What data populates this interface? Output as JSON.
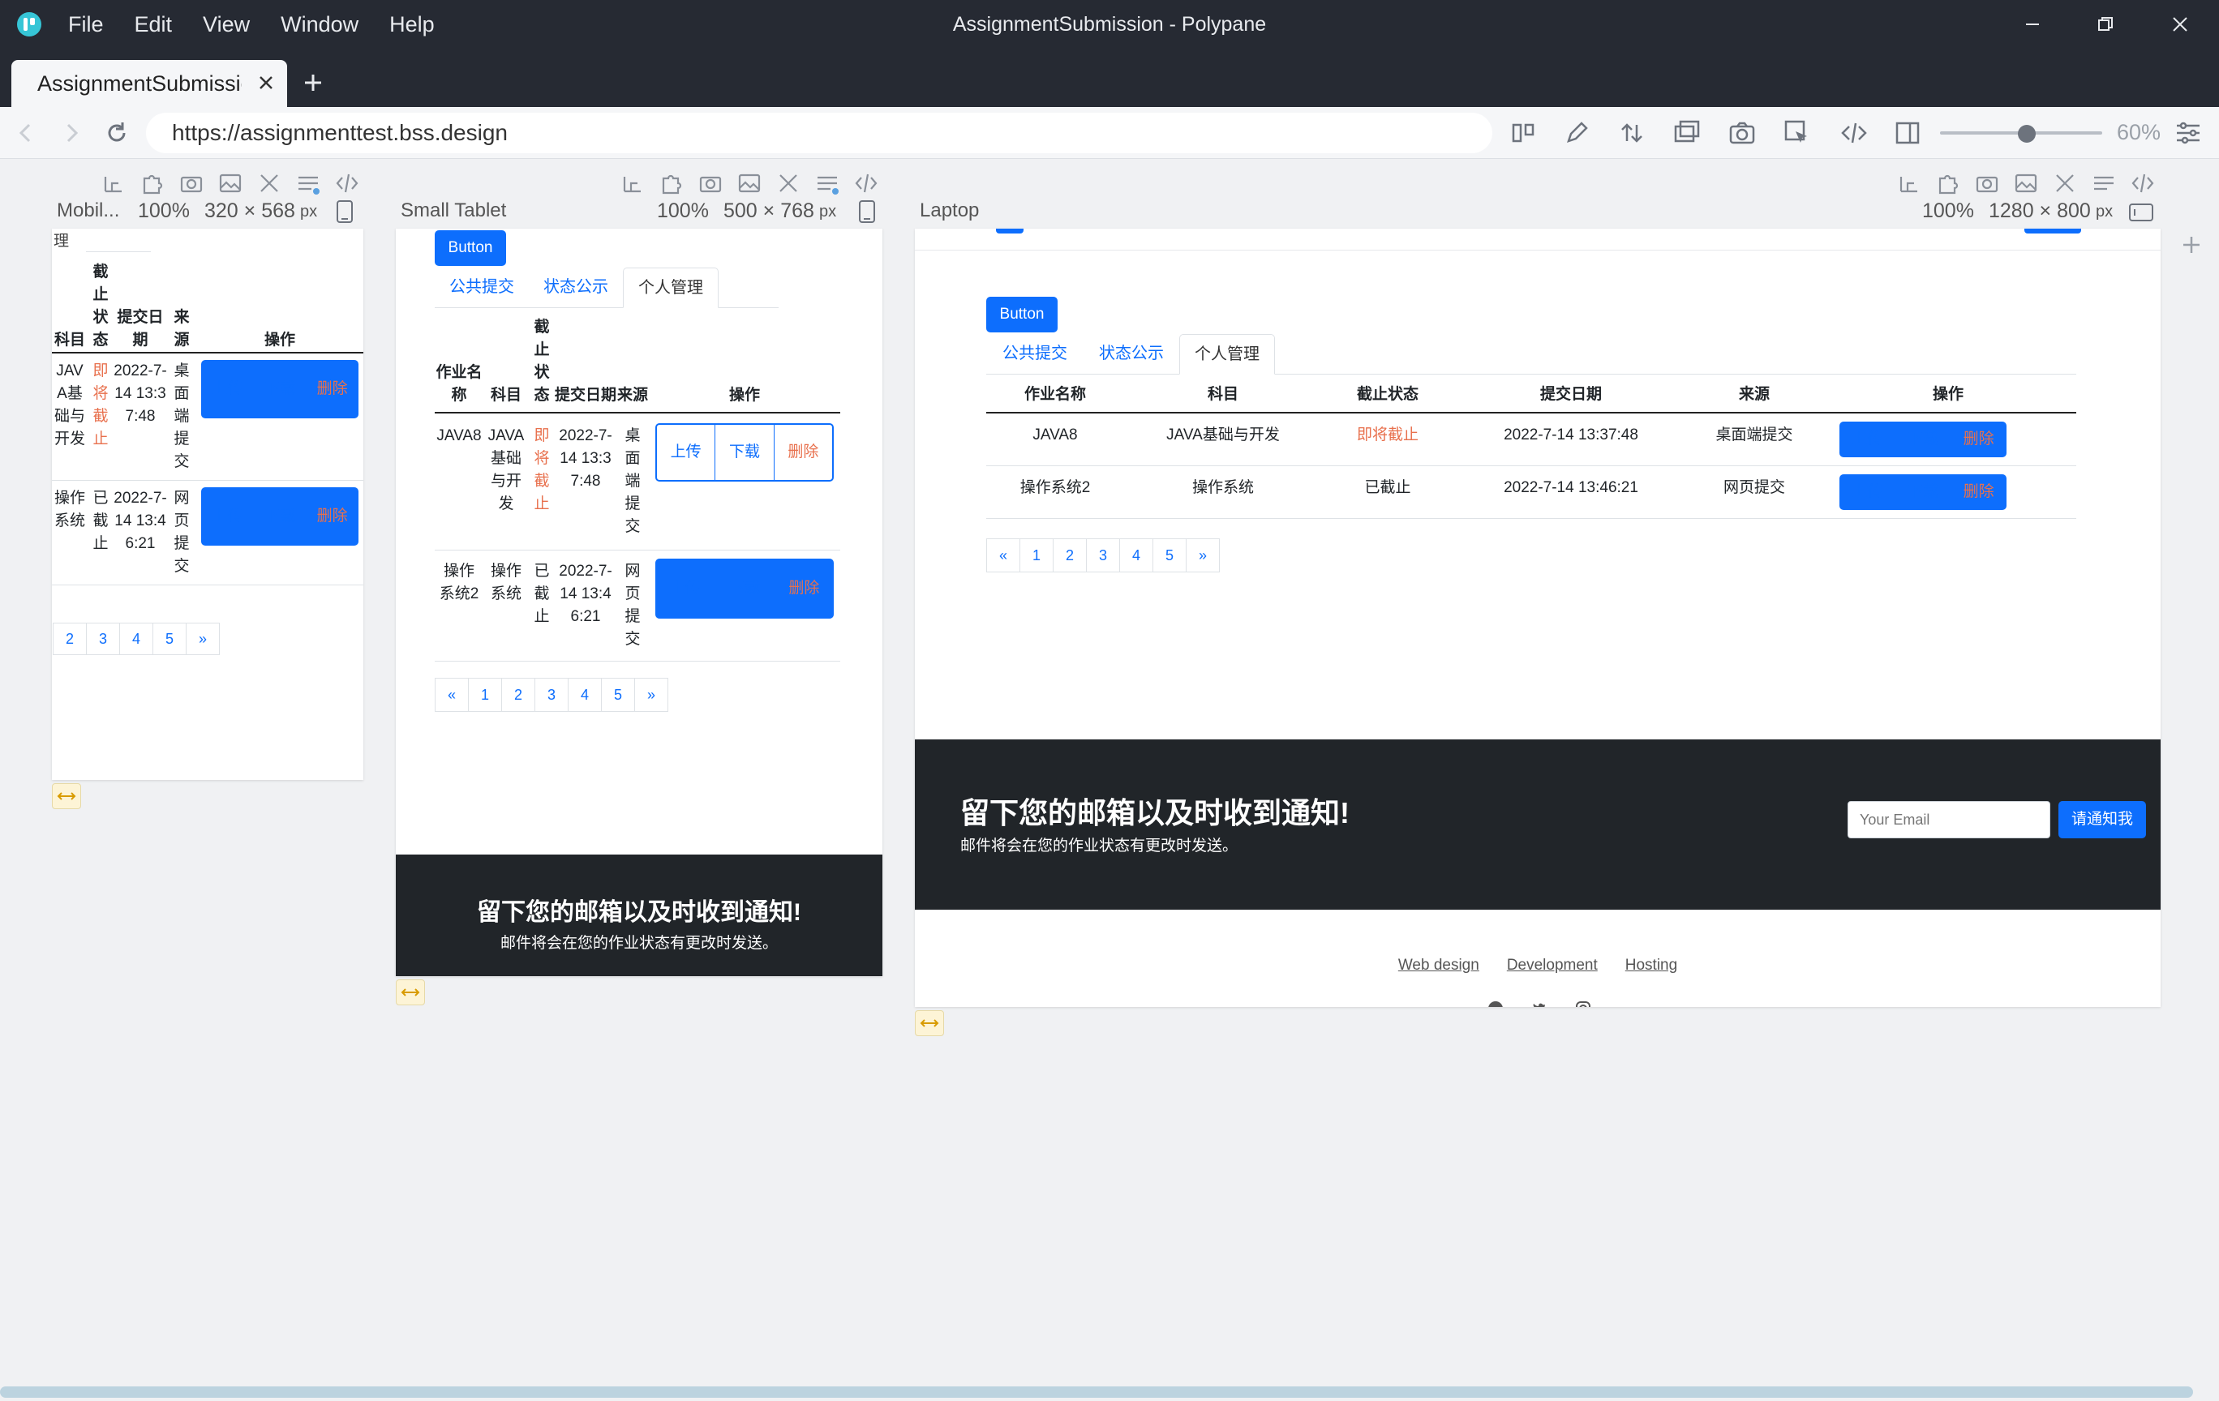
{
  "app": {
    "window_title": "AssignmentSubmission - Polypane",
    "menu": [
      "File",
      "Edit",
      "View",
      "Window",
      "Help"
    ],
    "tab_title": "AssignmentSubmission",
    "url": "https://assignmenttest.bss.design",
    "zoom": "60%"
  },
  "panes": [
    {
      "label": "Mobil...",
      "zoom": "100%",
      "size": "320 × 568",
      "unit": "px"
    },
    {
      "label": "Small Tablet",
      "zoom": "100%",
      "size": "500 × 768",
      "unit": "px"
    },
    {
      "label": "Laptop",
      "zoom": "100%",
      "size": "1280 × 800",
      "unit": "px"
    }
  ],
  "page": {
    "button": "Button",
    "tabs": [
      "公共提交",
      "状态公示",
      "个人管理"
    ],
    "columns": [
      "作业名称",
      "科目",
      "截止状态",
      "提交日期",
      "来源",
      "操作"
    ],
    "rows": [
      {
        "name": "JAVA8",
        "subject": "JAVA基础与开发",
        "status": "即将截止",
        "date": "2022-7-14 13:37:48",
        "source": "桌面端提交"
      },
      {
        "name": "操作系统2",
        "subject": "操作系统",
        "status": "已截止",
        "date": "2022-7-14 13:46:21",
        "source": "网页提交"
      }
    ],
    "actions": [
      "上传",
      "下载",
      "删除"
    ],
    "pagination": [
      "«",
      "1",
      "2",
      "3",
      "4",
      "5",
      "»"
    ],
    "newsletter_title": "留下您的邮箱以及时收到通知!",
    "newsletter_sub": "邮件将会在您的作业状态有更改时发送。",
    "email_placeholder": "Your Email",
    "notify_button": "请通知我",
    "footer_links": [
      "Web design",
      "Development",
      "Hosting"
    ],
    "mobile_cut_text": "理"
  }
}
